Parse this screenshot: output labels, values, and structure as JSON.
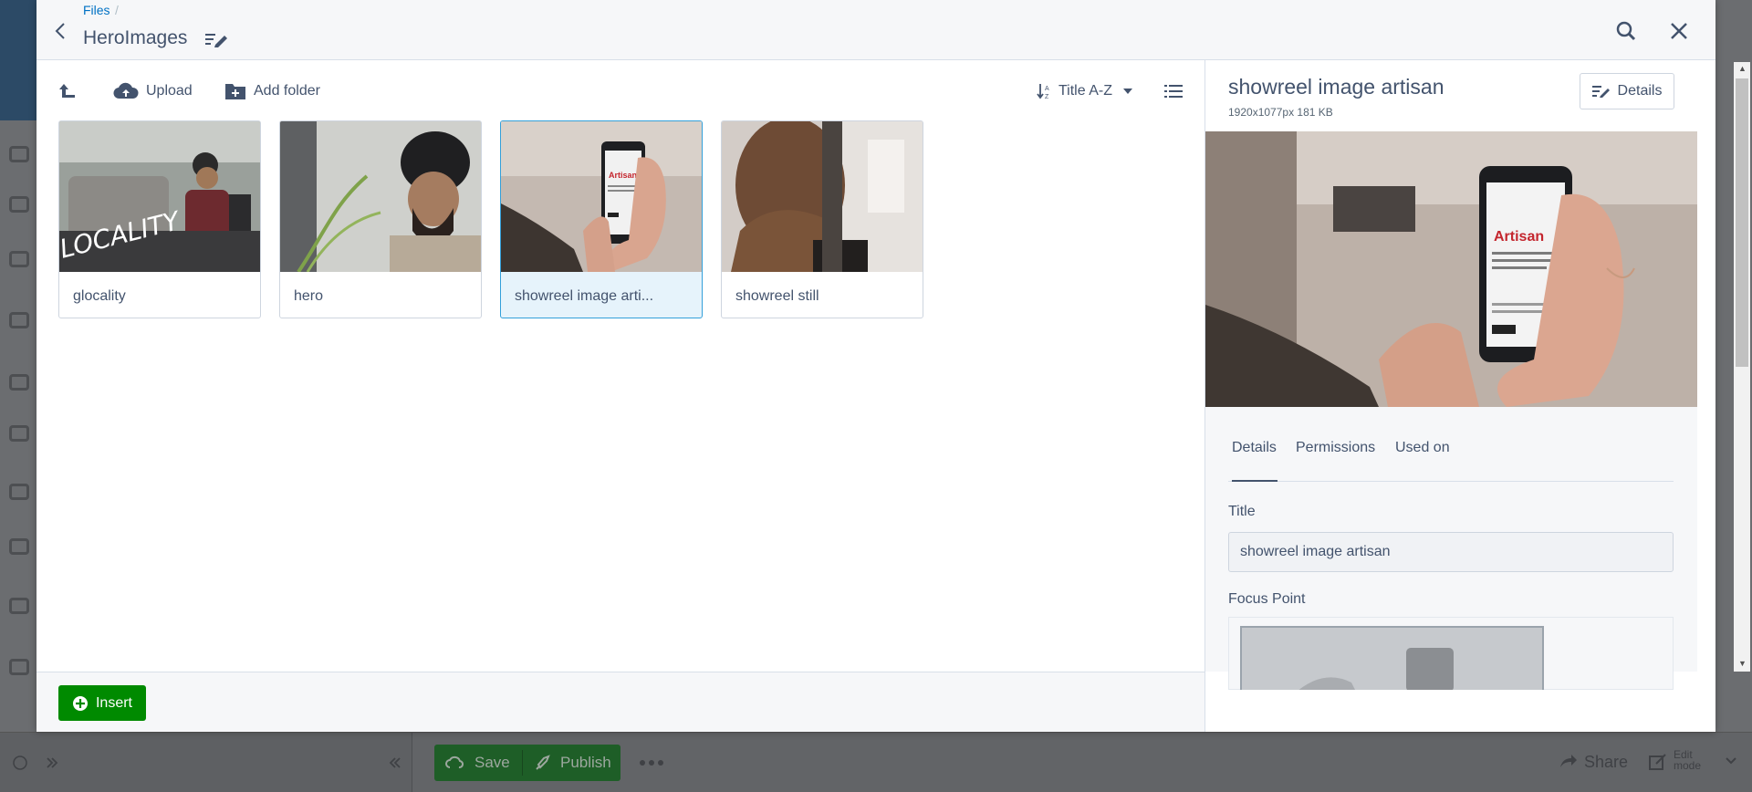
{
  "background_app": {
    "save_label": "Save",
    "publish_label": "Publish",
    "share_label": "Share",
    "edit_mode_label": "Edit mode"
  },
  "modal": {
    "breadcrumb": "Files",
    "breadcrumb_separator": "/",
    "title": "HeroImages",
    "toolbar": {
      "upload_label": "Upload",
      "add_folder_label": "Add folder",
      "sort_label": "Title A-Z"
    },
    "files": [
      {
        "label": "glocality",
        "selected": false
      },
      {
        "label": "hero",
        "selected": false
      },
      {
        "label": "showreel image arti...",
        "selected": true
      },
      {
        "label": "showreel still",
        "selected": false
      }
    ],
    "insert_label": "Insert",
    "details": {
      "title": "showreel image artisan",
      "meta": "1920x1077px 181 KB",
      "details_button_label": "Details",
      "tabs": [
        "Details",
        "Permissions",
        "Used on"
      ],
      "active_tab": "Details",
      "title_field_label": "Title",
      "title_field_value": "showreel image artisan",
      "focus_point_label": "Focus Point"
    }
  },
  "colors": {
    "accent_link": "#0071c4",
    "selection_border": "#33a0da",
    "insert_green": "#008a00",
    "text": "#43536d"
  },
  "icons": [
    "back-icon",
    "edit-title-icon",
    "search-icon",
    "close-icon",
    "upload-arrow-icon",
    "cloud-upload-icon",
    "add-folder-icon",
    "sort-icon",
    "caret-down-icon",
    "list-view-icon",
    "plus-circle-icon",
    "edit-icon"
  ]
}
